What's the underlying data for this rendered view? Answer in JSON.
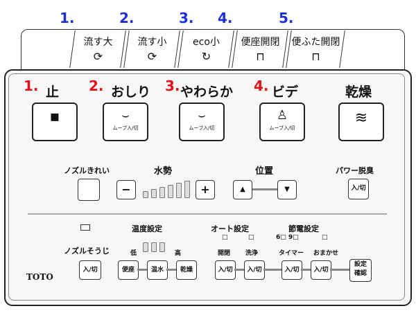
{
  "top_numbers": [
    "1.",
    "2.",
    "3.",
    "4.",
    "5."
  ],
  "top_buttons": [
    {
      "label": "流す大",
      "glyph": "⟳"
    },
    {
      "label": "流す小",
      "glyph": "⟳"
    },
    {
      "label": "eco小",
      "glyph": "↻"
    },
    {
      "label": "便座開閉",
      "glyph": "⊓"
    },
    {
      "label": "便ふた開閉",
      "glyph": "⊓"
    }
  ],
  "main_numbers": [
    "1.",
    "2.",
    "3.",
    "4."
  ],
  "main_buttons": [
    {
      "label": "止",
      "icon": "▪",
      "sub": ""
    },
    {
      "label": "おしり",
      "icon": "⌣",
      "sub": "ムーブ入/切"
    },
    {
      "label": "やわらか",
      "icon": "⌣",
      "sub": "ムーブ入/切"
    },
    {
      "label": "ビデ",
      "icon": "♙",
      "sub": "ムーブ入/切"
    },
    {
      "label": "乾燥",
      "icon": "≋",
      "sub": ""
    }
  ],
  "row2": {
    "nozzle_clean": "ノズルきれい",
    "water_pressure": "水勢",
    "minus": "−",
    "plus": "+",
    "position": "位置",
    "up": "▲",
    "down": "▼",
    "power_deodorize": "パワー脱臭",
    "power_toggle": "入/切"
  },
  "row3": {
    "temp_setting": "温度設定",
    "low": "低",
    "high": "高",
    "nozzle_sou": "ノズルそうじ",
    "toggle": "入/切",
    "seat": "便座",
    "water_temp": "温水",
    "dry": "乾燥",
    "auto_setting": "オート設定",
    "open_close": "開閉",
    "wash": "洗浄",
    "energy_setting": "節電設定",
    "hours": "6□ 9□",
    "timer": "タイマー",
    "omakase": "おまかせ",
    "settings_confirm_1": "設定",
    "settings_confirm_2": "確認",
    "brand": "TOTO",
    "checkbox": "□"
  }
}
